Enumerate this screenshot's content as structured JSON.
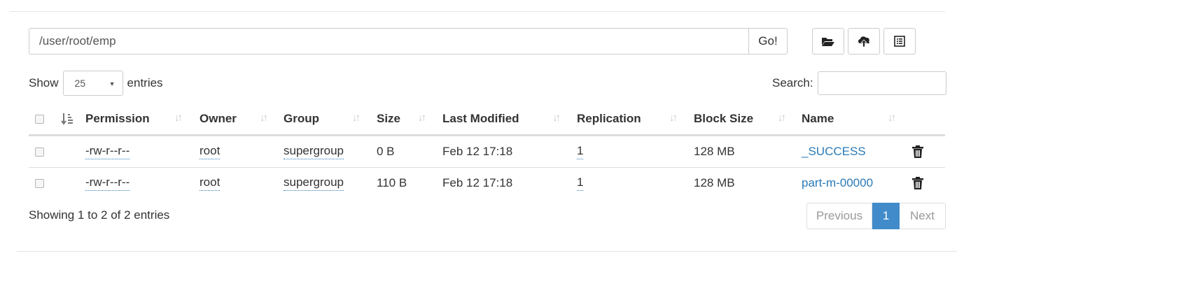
{
  "path": {
    "value": "/user/root/emp",
    "go_label": "Go!"
  },
  "toolbar": {
    "icons": [
      "folder-open-icon",
      "cloud-upload-icon",
      "list-alt-icon"
    ]
  },
  "entries": {
    "show_label": "Show",
    "selected": "25",
    "suffix": "entries"
  },
  "search": {
    "label": "Search:",
    "value": ""
  },
  "table": {
    "headers": {
      "permission": "Permission",
      "owner": "Owner",
      "group": "Group",
      "size": "Size",
      "last_modified": "Last Modified",
      "replication": "Replication",
      "block_size": "Block Size",
      "name": "Name"
    },
    "rows": [
      {
        "permission": "-rw-r--r--",
        "owner": "root",
        "group": "supergroup",
        "size": "0 B",
        "last_modified": "Feb 12 17:18",
        "replication": "1",
        "block_size": "128 MB",
        "name": "_SUCCESS"
      },
      {
        "permission": "-rw-r--r--",
        "owner": "root",
        "group": "supergroup",
        "size": "110 B",
        "last_modified": "Feb 12 17:18",
        "replication": "1",
        "block_size": "128 MB",
        "name": "part-m-00000"
      }
    ]
  },
  "footer": {
    "info": "Showing 1 to 2 of 2 entries",
    "previous": "Previous",
    "current_page": "1",
    "next": "Next"
  },
  "colors": {
    "link": "#2a7ab8",
    "active_page": "#428bca"
  }
}
